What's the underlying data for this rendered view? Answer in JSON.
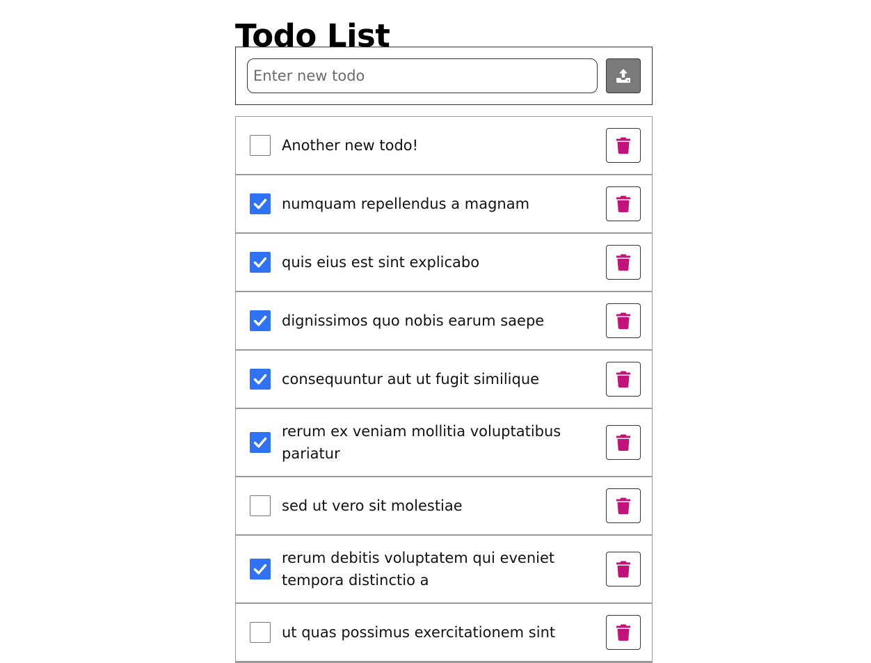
{
  "page": {
    "title": "Todo List"
  },
  "new_todo": {
    "placeholder": "Enter new todo",
    "value": "",
    "submit_icon": "upload-icon"
  },
  "todos": [
    {
      "text": "Another new todo!",
      "completed": false
    },
    {
      "text": "numquam repellendus a magnam",
      "completed": true
    },
    {
      "text": "quis eius est sint explicabo",
      "completed": true
    },
    {
      "text": "dignissimos quo nobis earum saepe",
      "completed": true
    },
    {
      "text": "consequuntur aut ut fugit similique",
      "completed": true
    },
    {
      "text": "rerum ex veniam mollitia voluptatibus pariatur",
      "completed": true
    },
    {
      "text": "sed ut vero sit molestiae",
      "completed": false
    },
    {
      "text": "rerum debitis voluptatem qui eveniet tempora distinctio a",
      "completed": true
    },
    {
      "text": "ut quas possimus exercitationem sint",
      "completed": false
    }
  ],
  "icons": {
    "delete": "trash-icon",
    "check": "checkmark-icon"
  },
  "colors": {
    "checkbox_checked": "#2f72f5",
    "delete_icon": "#c2137a",
    "submit_button": "#7a7a7a"
  }
}
